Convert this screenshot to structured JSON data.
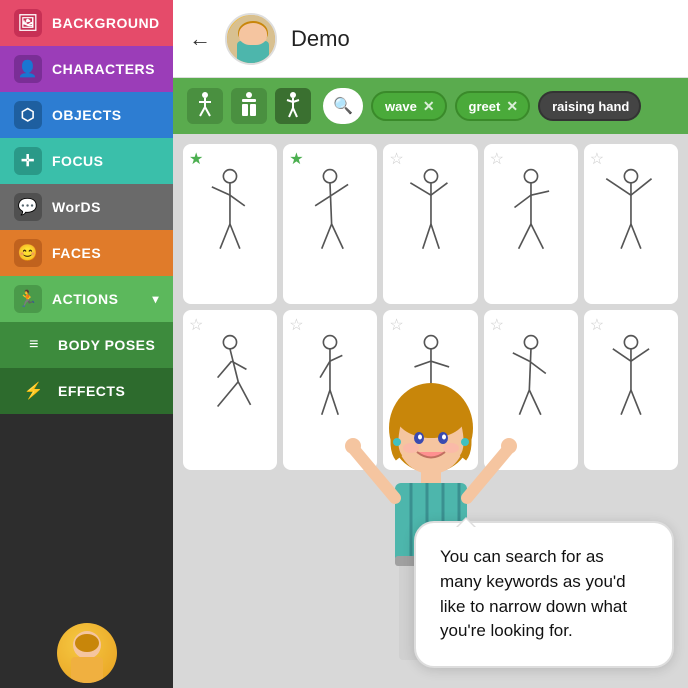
{
  "sidebar": {
    "items": [
      {
        "id": "background",
        "label": "BACKGROUND",
        "icon": "🖼",
        "class": "background"
      },
      {
        "id": "characters",
        "label": "CHARACTERS",
        "icon": "👤",
        "class": "characters"
      },
      {
        "id": "objects",
        "label": "OBJECTS",
        "icon": "⬡",
        "class": "objects"
      },
      {
        "id": "focus",
        "label": "FOCUS",
        "icon": "✛",
        "class": "focus"
      },
      {
        "id": "words",
        "label": "WorDS",
        "icon": "💬",
        "class": "words"
      },
      {
        "id": "faces",
        "label": "FACES",
        "icon": "😊",
        "class": "faces"
      },
      {
        "id": "actions",
        "label": "ACTIONS",
        "icon": "🏃",
        "class": "actions"
      },
      {
        "id": "body-poses",
        "label": "BODY POSES",
        "icon": "≡",
        "class": "body-poses"
      },
      {
        "id": "effects",
        "label": "EFFECTS",
        "icon": "⚡",
        "class": "effects"
      }
    ]
  },
  "header": {
    "back_label": "←",
    "title": "Demo"
  },
  "toolbar": {
    "tags": [
      {
        "id": "wave",
        "label": "wave",
        "style": "green"
      },
      {
        "id": "greet",
        "label": "greet",
        "style": "green"
      },
      {
        "id": "raising-hand",
        "label": "raising hand",
        "style": "dark"
      }
    ]
  },
  "grid": {
    "cards": [
      {
        "star": true
      },
      {
        "star": true
      },
      {
        "star": false
      },
      {
        "star": false
      },
      {
        "star": false
      },
      {
        "star": false
      },
      {
        "star": false
      },
      {
        "star": false
      },
      {
        "star": false
      },
      {
        "star": false
      }
    ]
  },
  "speech_bubble": {
    "text": "You can search for as many keywords as you'd like to narrow down what you're looking for."
  }
}
